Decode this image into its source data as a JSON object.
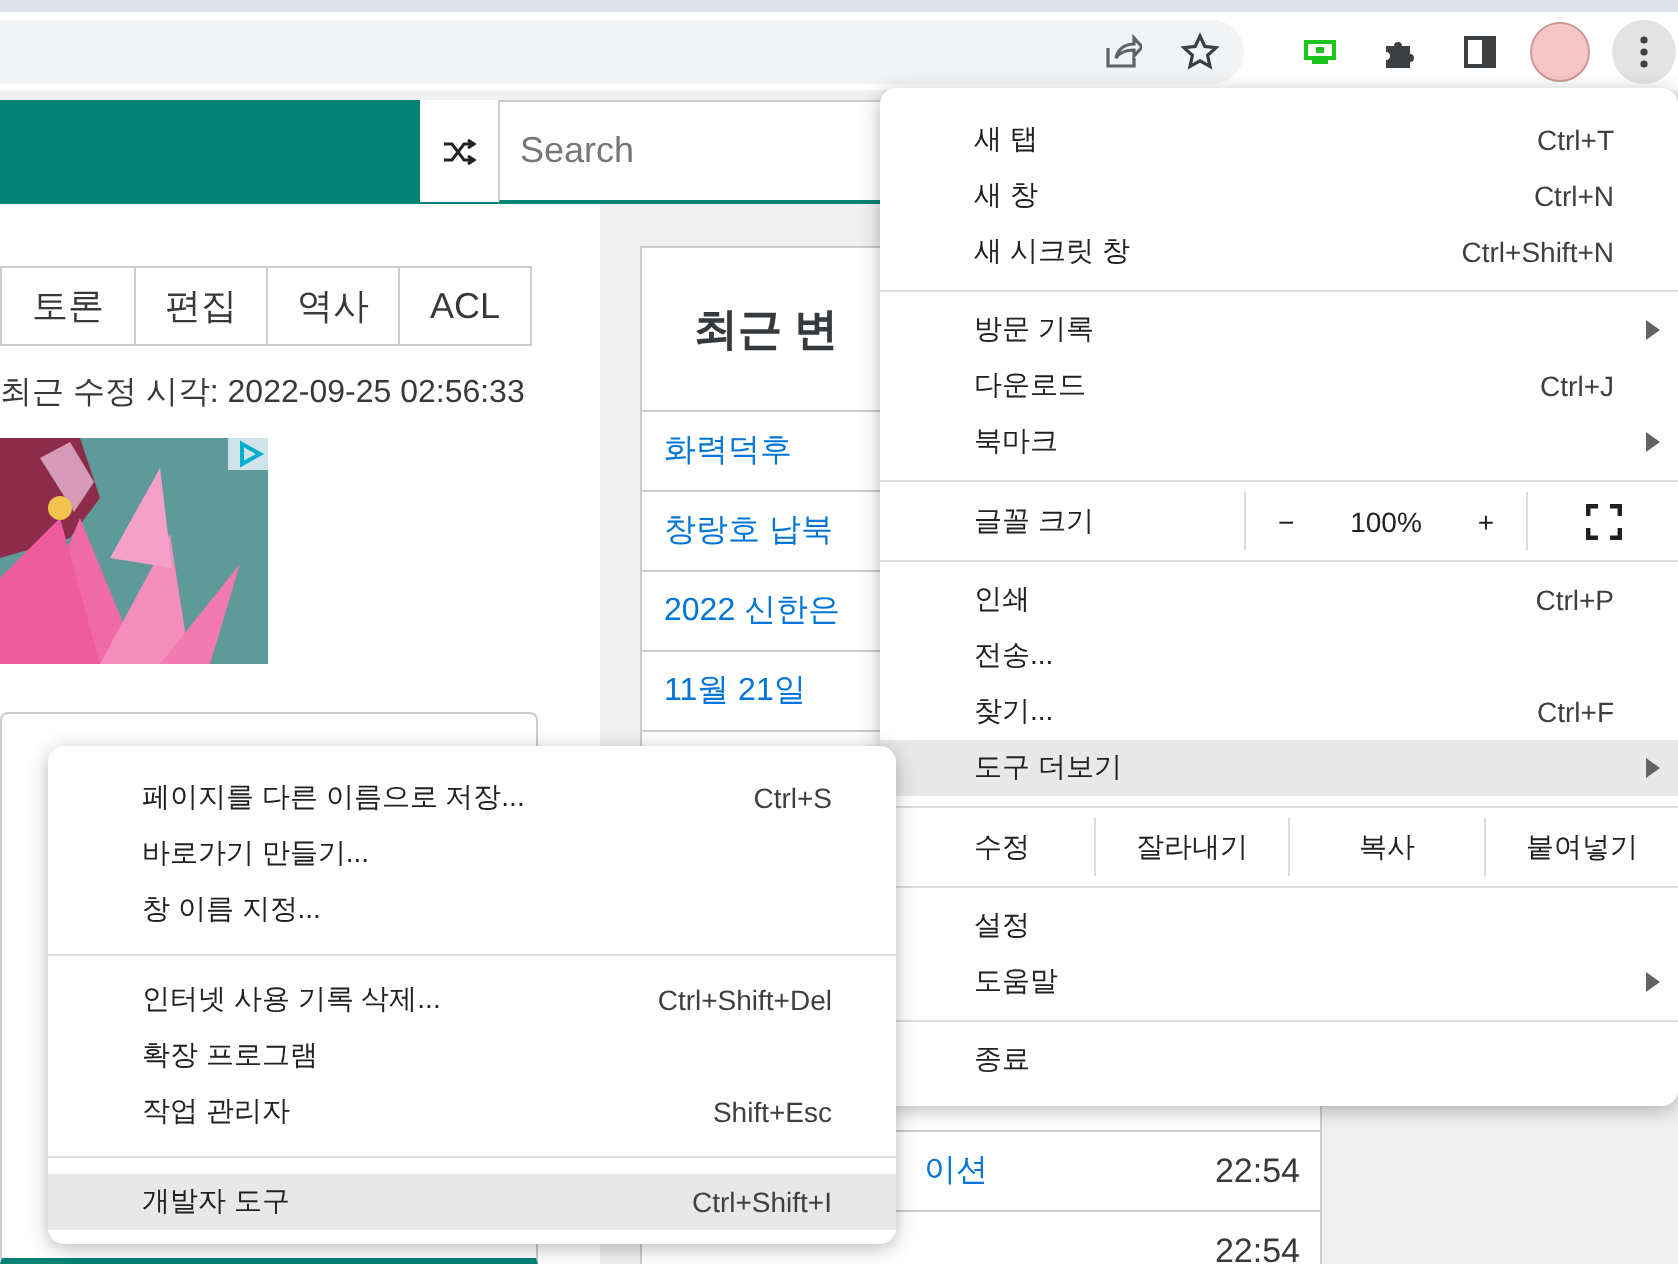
{
  "toolbar": {
    "menu_button": {
      "pressed": true
    }
  },
  "wiki": {
    "search": {
      "placeholder": "Search"
    },
    "tabs": [
      {
        "label": "토론"
      },
      {
        "label": "편집"
      },
      {
        "label": "역사"
      },
      {
        "label": "ACL"
      }
    ],
    "last_modified": "최근 수정 시각: 2022-09-25 02:56:33"
  },
  "sidebar": {
    "title": "최근 변",
    "rows": [
      {
        "title": "화력덕후"
      },
      {
        "title": "창랑호 납북"
      },
      {
        "title": "2022 신한은"
      },
      {
        "title": "11월 21일"
      }
    ],
    "bottom_rows": [
      {
        "title": "이션",
        "time": "22:54"
      },
      {
        "time": "22:54"
      }
    ]
  },
  "chrome_menu": {
    "sections": [
      [
        {
          "kind": "item",
          "label": "새 탭",
          "shortcut": "Ctrl+T",
          "submenu": false,
          "selected": false
        },
        {
          "kind": "item",
          "label": "새 창",
          "shortcut": "Ctrl+N",
          "submenu": false,
          "selected": false
        },
        {
          "kind": "item",
          "label": "새 시크릿 창",
          "shortcut": "Ctrl+Shift+N",
          "submenu": false,
          "selected": false
        }
      ],
      [
        {
          "kind": "item",
          "label": "방문 기록",
          "submenu": true,
          "selected": false
        },
        {
          "kind": "item",
          "label": "다운로드",
          "shortcut": "Ctrl+J",
          "submenu": false,
          "selected": false
        },
        {
          "kind": "item",
          "label": "북마크",
          "submenu": true,
          "selected": false
        }
      ],
      [
        {
          "kind": "zoom",
          "label": "글꼴 크기",
          "minus": "−",
          "value": "100%",
          "plus": "+"
        }
      ],
      [
        {
          "kind": "item",
          "label": "인쇄",
          "shortcut": "Ctrl+P",
          "submenu": false,
          "selected": false
        },
        {
          "kind": "item",
          "label": "전송...",
          "submenu": false,
          "selected": false
        },
        {
          "kind": "item",
          "label": "찾기...",
          "shortcut": "Ctrl+F",
          "submenu": false,
          "selected": false
        },
        {
          "kind": "item",
          "label": "도구 더보기",
          "submenu": true,
          "selected": true
        }
      ],
      [
        {
          "kind": "edit",
          "label": "수정",
          "actions": [
            "잘라내기",
            "복사",
            "붙여넣기"
          ]
        }
      ],
      [
        {
          "kind": "item",
          "label": "설정",
          "submenu": false,
          "selected": false
        },
        {
          "kind": "item",
          "label": "도움말",
          "submenu": true,
          "selected": false
        }
      ],
      [
        {
          "kind": "item",
          "label": "종료",
          "submenu": false,
          "selected": false
        }
      ]
    ]
  },
  "submenu": {
    "sections": [
      [
        {
          "kind": "item",
          "label": "페이지를 다른 이름으로 저장...",
          "shortcut": "Ctrl+S",
          "submenu": false,
          "selected": false
        },
        {
          "kind": "item",
          "label": "바로가기 만들기...",
          "submenu": false,
          "selected": false
        },
        {
          "kind": "item",
          "label": "창 이름 지정...",
          "submenu": false,
          "selected": false
        }
      ],
      [
        {
          "kind": "item",
          "label": "인터넷 사용 기록 삭제...",
          "shortcut": "Ctrl+Shift+Del",
          "submenu": false,
          "selected": false
        },
        {
          "kind": "item",
          "label": "확장 프로그램",
          "submenu": false,
          "selected": false
        },
        {
          "kind": "item",
          "label": "작업 관리자",
          "shortcut": "Shift+Esc",
          "submenu": false,
          "selected": false
        }
      ],
      [
        {
          "kind": "item",
          "label": "개발자 도구",
          "shortcut": "Ctrl+Shift+I",
          "submenu": false,
          "selected": true
        }
      ]
    ]
  }
}
